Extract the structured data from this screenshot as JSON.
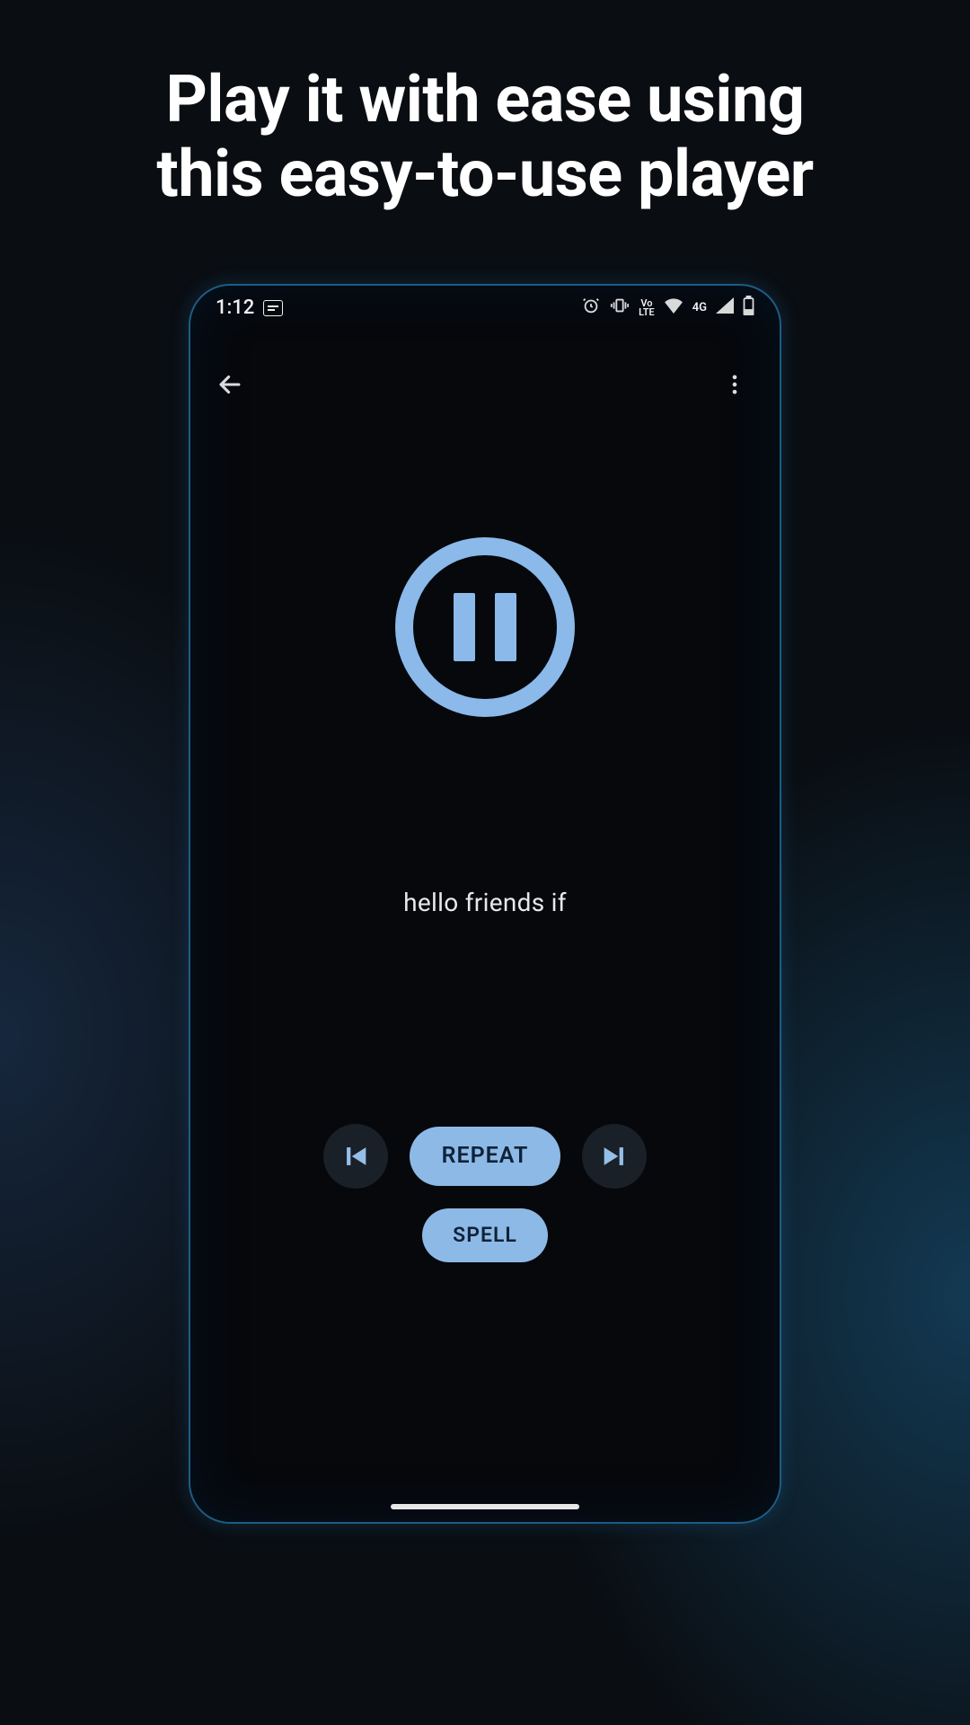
{
  "promo": {
    "headline_line1": "Play it with ease using",
    "headline_line2": "this easy-to-use player"
  },
  "status_bar": {
    "time": "1:12",
    "volte_top": "Vo",
    "volte_bottom": "LTE",
    "network_label": "4G"
  },
  "player": {
    "transcript": "hello friends if"
  },
  "controls": {
    "repeat_label": "REPEAT",
    "spell_label": "SPELL"
  }
}
